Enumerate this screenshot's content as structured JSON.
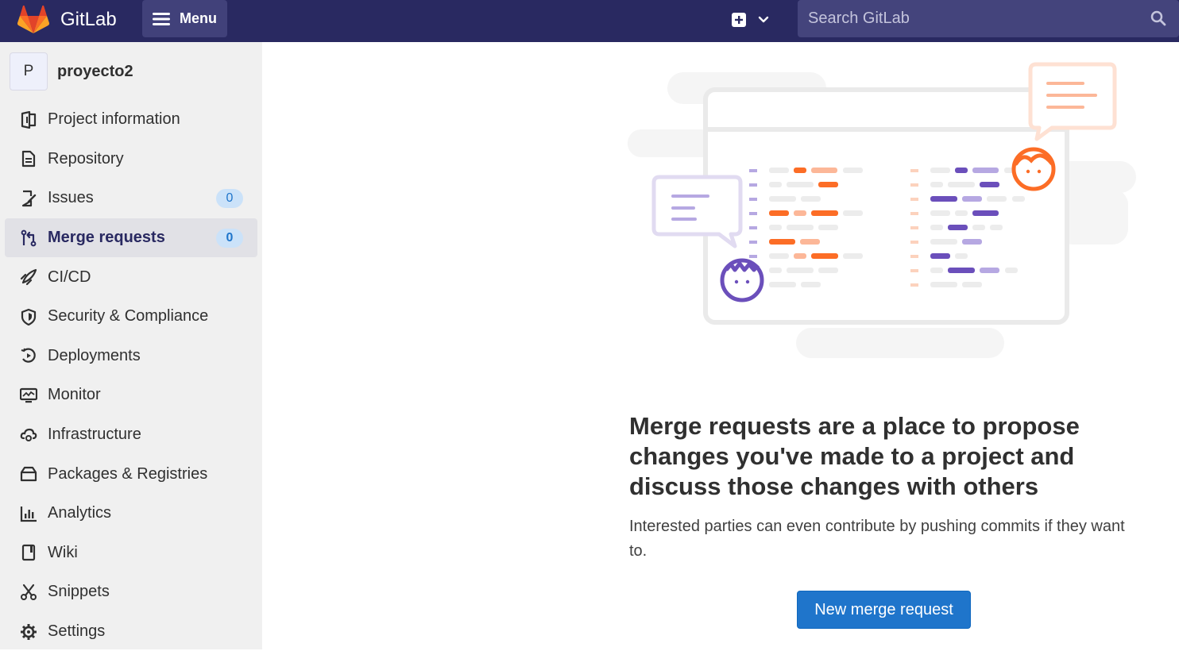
{
  "topbar": {
    "brand": "GitLab",
    "menu_label": "Menu",
    "search_placeholder": "Search GitLab"
  },
  "project": {
    "avatar_letter": "P",
    "name": "proyecto2"
  },
  "nav": [
    {
      "label": "Project information",
      "icon": "project-icon"
    },
    {
      "label": "Repository",
      "icon": "repository-icon"
    },
    {
      "label": "Issues",
      "icon": "issues-icon",
      "badge": "0"
    },
    {
      "label": "Merge requests",
      "icon": "merge-request-icon",
      "badge": "0",
      "active": true
    },
    {
      "label": "CI/CD",
      "icon": "rocket-icon"
    },
    {
      "label": "Security & Compliance",
      "icon": "shield-icon"
    },
    {
      "label": "Deployments",
      "icon": "deployments-icon"
    },
    {
      "label": "Monitor",
      "icon": "monitor-icon"
    },
    {
      "label": "Infrastructure",
      "icon": "cloud-gear-icon"
    },
    {
      "label": "Packages & Registries",
      "icon": "package-icon"
    },
    {
      "label": "Analytics",
      "icon": "chart-icon"
    },
    {
      "label": "Wiki",
      "icon": "book-icon"
    },
    {
      "label": "Snippets",
      "icon": "scissors-icon"
    },
    {
      "label": "Settings",
      "icon": "gear-icon"
    }
  ],
  "empty_state": {
    "title": "Merge requests are a place to propose changes you've made to a project and discuss those changes with others",
    "description": "Interested parties can even contribute by pushing commits if they want to.",
    "button": "New merge request"
  },
  "colors": {
    "topbar": "#292961",
    "primary": "#1f75cb",
    "orange": "#fc6d26",
    "purple": "#6b4fbb"
  }
}
